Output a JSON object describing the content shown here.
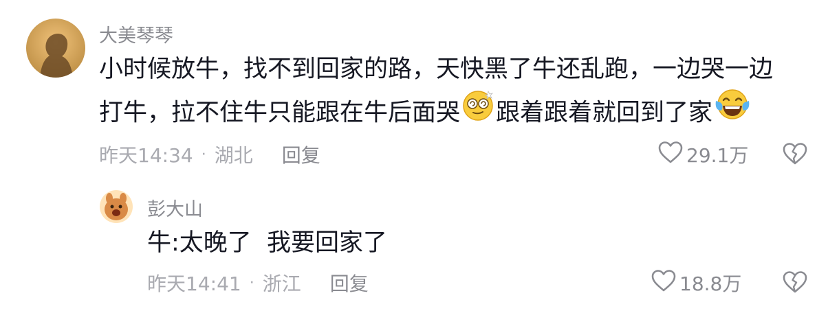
{
  "comments": [
    {
      "username": "大美琴琴",
      "text_line1": "小时候放牛，找不到回家的路，天快黑了牛还乱跑，一边哭一边",
      "text_line2_a": "打牛，拉不住牛只能跟在牛后面哭",
      "text_line2_b": "跟着跟着就回到了家",
      "emoji_1": "dizzy-face-icon",
      "emoji_2": "tears-of-joy-icon",
      "time": "昨天14:34",
      "location": "湖北",
      "reply_label": "回复",
      "likes": "29.1万",
      "separator": "·"
    }
  ],
  "replies": [
    {
      "username": "彭大山",
      "text": "牛:太晚了  我要回家了",
      "time": "昨天14:41",
      "location": "浙江",
      "reply_label": "回复",
      "likes": "18.8万",
      "separator": "·"
    }
  ],
  "colors": {
    "text": "#161823",
    "username": "#8a8b91",
    "meta": "#a9aab0"
  }
}
